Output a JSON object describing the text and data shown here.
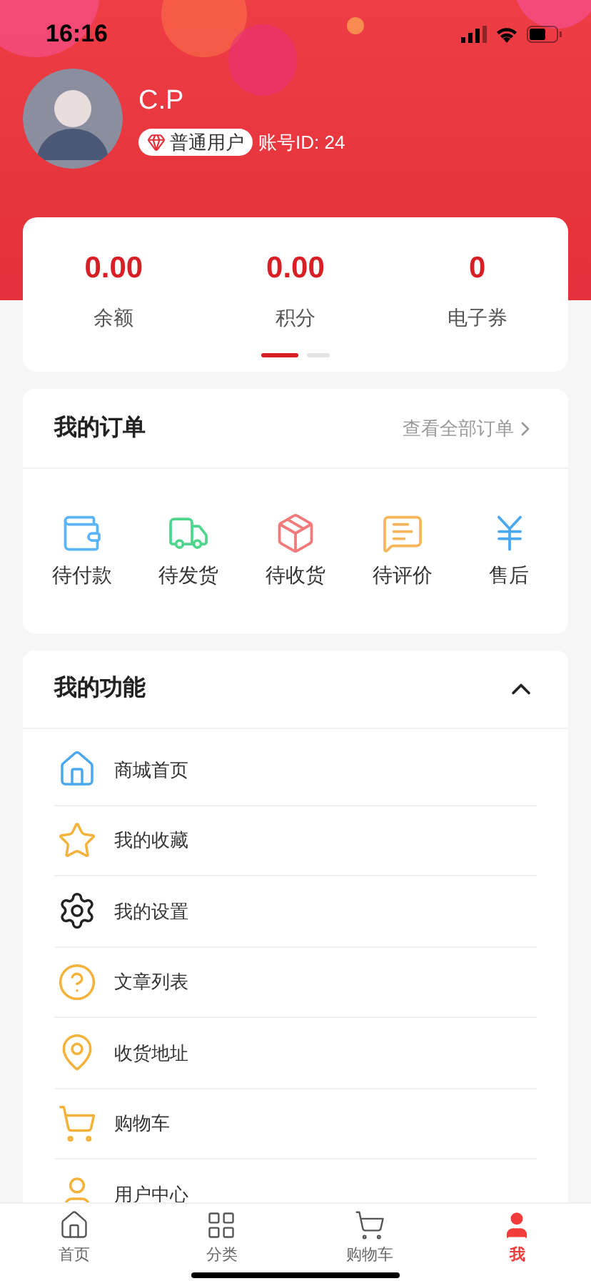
{
  "status_bar": {
    "time": "16:16"
  },
  "profile": {
    "name": "C.P",
    "badge": "普通用户",
    "account": "账号ID: 24"
  },
  "stats": [
    {
      "value": "0.00",
      "label": "余额"
    },
    {
      "value": "0.00",
      "label": "积分"
    },
    {
      "value": "0",
      "label": "电子券"
    }
  ],
  "pager": [
    {
      "selected": true
    },
    {
      "selected": false
    }
  ],
  "orders": {
    "title": "我的订单",
    "link": "查看全部订单",
    "items": [
      {
        "kind": "wallet",
        "label": "待付款"
      },
      {
        "kind": "truck",
        "label": "待发货"
      },
      {
        "kind": "box",
        "label": "待收货"
      },
      {
        "kind": "comment",
        "label": "待评价"
      },
      {
        "kind": "yen",
        "label": "售后"
      }
    ]
  },
  "functions": {
    "title": "我的功能",
    "expanded": true,
    "items": [
      {
        "kind": "home",
        "label": "商城首页"
      },
      {
        "kind": "star",
        "label": "我的收藏"
      },
      {
        "kind": "gear",
        "label": "我的设置"
      },
      {
        "kind": "question",
        "label": "文章列表"
      },
      {
        "kind": "pin",
        "label": "收货地址"
      },
      {
        "kind": "cart",
        "label": "购物车"
      },
      {
        "kind": "user",
        "label": "用户中心"
      }
    ]
  },
  "tab_bar": [
    {
      "kind": "home",
      "label": "首页",
      "selected": false
    },
    {
      "kind": "grid",
      "label": "分类",
      "selected": false
    },
    {
      "kind": "cart",
      "label": "购物车",
      "selected": false
    },
    {
      "kind": "user",
      "label": "我",
      "selected": true
    }
  ]
}
